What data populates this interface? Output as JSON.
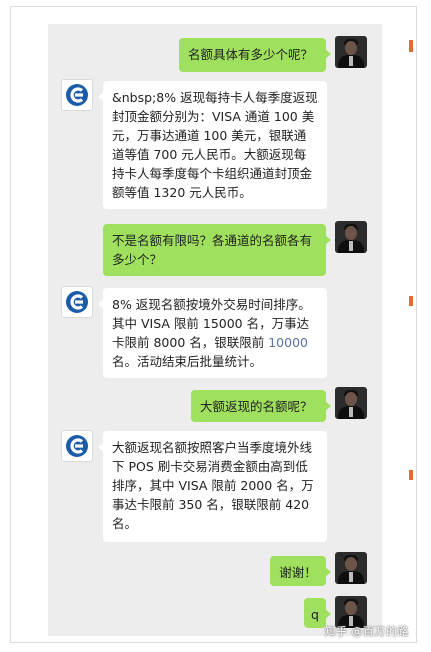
{
  "watermark": "知乎 @百万的路",
  "messages": [
    {
      "from": "user",
      "text": "名额具体有多少个呢？"
    },
    {
      "from": "bank",
      "text": "&nbsp;8% 返现每持卡人每季度返现封顶金额分别为：VISA 通道 100 美元，万事达通道 100 美元，银联通道等值 700 元人民币。大额返现每持卡人每季度每个卡组织通道封顶金额等值 1320 元人民币。"
    },
    {
      "from": "user",
      "text": "不是名额有限吗？各通道的名额各有多少个？"
    },
    {
      "from": "bank",
      "text_a": "8% 返现名额按境外交易时间排序。其中 VISA 限前 15000 名，万事达卡限前 8000 名，银联限前 ",
      "text_hl": "10000",
      "text_b": " 名。活动结束后批量统计。"
    },
    {
      "from": "user",
      "text": "大额返现的名额呢？"
    },
    {
      "from": "bank",
      "text": "大额返现名额按照客户当季度境外线下 POS 刷卡交易消费金额由高到低排序，其中 VISA 限前 2000 名，万事达卡限前 350 名，银联限前 420 名。"
    },
    {
      "from": "user",
      "text": "谢谢！"
    },
    {
      "from": "user",
      "text": "q"
    }
  ],
  "icons": {
    "user_avatar": "portrait-icon",
    "bank_avatar": "ccb-logo-icon"
  },
  "colors": {
    "outgoing": "#9fe05e",
    "incoming": "#ffffff",
    "chat_bg": "#ededed",
    "logo": "#1a5ca8"
  }
}
